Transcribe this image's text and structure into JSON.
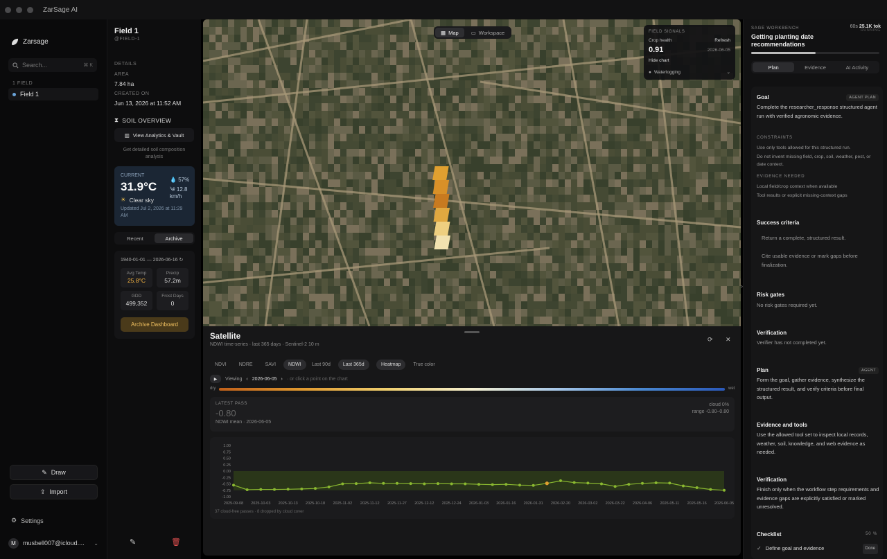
{
  "app": {
    "title": "ZarSage AI"
  },
  "nav": {
    "brand": "Zarsage",
    "search_placeholder": "Search...",
    "search_kbd": "⌘ K",
    "section": "1 FIELD",
    "items": [
      {
        "label": "Field 1"
      }
    ],
    "draw": "Draw",
    "import": "Import",
    "settings": "Settings",
    "user_initial": "M",
    "user_email": "musbell007@icloud...."
  },
  "field": {
    "name": "Field 1",
    "id": "@FIELD-1",
    "details": "DETAILS",
    "area_label": "AREA",
    "area": "7.84 ha",
    "created_label": "CREATED ON",
    "created": "Jun 13, 2026 at 11:52 AM",
    "soil_header": "SOIL OVERVIEW",
    "vault_btn": "View Analytics & Vault",
    "soil_note": "Get detailed soil composition analysis"
  },
  "weather": {
    "label": "CURRENT",
    "temp": "31.9°C",
    "sky": "Clear sky",
    "humidity": "57%",
    "wind": "12.8 km/h",
    "updated": "Updated Jul 2, 2026 at 11:29 AM"
  },
  "history": {
    "tabs": [
      "Recent",
      "Archive"
    ],
    "range": "1940-01-01 — 2026-06-16",
    "stats": [
      {
        "k": "Avg Temp",
        "v": "25.8°C"
      },
      {
        "k": "Precip",
        "v": "57.2m"
      },
      {
        "k": "GDD",
        "v": "499,352"
      },
      {
        "k": "Frost Days",
        "v": "0"
      }
    ],
    "button": "Archive Dashboard"
  },
  "map": {
    "toggle": [
      "Map",
      "Workspace"
    ],
    "signals": {
      "header": "FIELD SIGNALS",
      "crop_label": "Crop health",
      "refresh": "Refresh",
      "value": "0.91",
      "date": "2026-06-05",
      "hide": "Hide chart",
      "alert": "Waterlogging"
    }
  },
  "satellite": {
    "title": "Satellite",
    "subtitle": "NDWI time-series · last 365 days · Sentinel-2 10 m",
    "indices": [
      "NDVI",
      "NDRE",
      "SAVI",
      "NDWI"
    ],
    "ranges": [
      "Last 90d",
      "Last 365d"
    ],
    "modes": [
      "Heatmap",
      "True color"
    ],
    "viewing": "Viewing",
    "date": "2026-06-05",
    "hint": "· or click a point on the chart",
    "dry": "dry",
    "wet": "wet",
    "latest_label": "LATEST PASS",
    "latest_value": "-0.80",
    "latest_sub": "NDWI mean · 2026-06-05",
    "cloud": "cloud 0%",
    "range": "range -0.80–0.80",
    "footer": "37 cloud-free passes · 8 dropped by cloud cover"
  },
  "chart_data": {
    "type": "line",
    "title": "",
    "xlabel": "",
    "ylabel": "",
    "ylim": [
      -1,
      1
    ],
    "yticks": [
      "1.00",
      "0.75",
      "0.50",
      "0.25",
      "0.00",
      "-0.25",
      "-0.50",
      "-0.75",
      "-1.00"
    ],
    "categories": [
      "2025-09-08",
      "2025-10-03",
      "2025-10-13",
      "2025-10-18",
      "2025-11-02",
      "2025-11-12",
      "2025-11-27",
      "2025-12-12",
      "2025-12-24",
      "2026-01-03",
      "2026-01-16",
      "2026-01-31",
      "2026-02-20",
      "2026-03-02",
      "2026-03-22",
      "2026-04-06",
      "2026-05-11",
      "2026-05-16",
      "2026-06-05"
    ],
    "values": [
      -0.55,
      -0.73,
      -0.72,
      -0.72,
      -0.71,
      -0.7,
      -0.68,
      -0.62,
      -0.5,
      -0.49,
      -0.46,
      -0.48,
      -0.48,
      -0.49,
      -0.5,
      -0.49,
      -0.5,
      -0.5,
      -0.52,
      -0.53,
      -0.52,
      -0.55,
      -0.56,
      -0.48,
      -0.38,
      -0.45,
      -0.47,
      -0.5,
      -0.6,
      -0.52,
      -0.48,
      -0.46,
      -0.47,
      -0.58,
      -0.65,
      -0.72,
      -0.75
    ],
    "highlight_index": 23
  },
  "sage": {
    "header": "SAGE WORKBENCH",
    "tokens": "25.1K tok",
    "elapsed": "60s",
    "status": "RUNNING",
    "title": "Getting planting date recommendations",
    "progress": 0.5,
    "tabs": [
      "Plan",
      "Evidence",
      "AI Activity"
    ],
    "goal": "Goal",
    "goal_pill": "AGENT PLAN",
    "goal_text": "Complete the researcher_response structured agent run with verified agronomic evidence.",
    "constraints": "CONSTRAINTS",
    "c1": "Use only tools allowed for this structured run.",
    "c2": "Do not invent missing field, crop, soil, weather, pest, or date context.",
    "evidence": "EVIDENCE NEEDED",
    "e1": "Local field/crop context when available",
    "e2": "Tool results or explicit missing-context gaps",
    "success": "Success criteria",
    "s1": "Return a complete, structured result.",
    "s2": "Cite usable evidence or mark gaps before finalization.",
    "risk": "Risk gates",
    "risk_text": "No risk gates required yet.",
    "verif": "Verification",
    "verif_text": "Verifier has not completed yet.",
    "plan": "Plan",
    "plan_pill": "AGENT",
    "plan_text": "Form the goal, gather evidence, synthesize the structured result, and verify criteria before final output.",
    "tools": "Evidence and tools",
    "tools_text": "Use the allowed tool set to inspect local records, weather, soil, knowledge, and web evidence as needed.",
    "verif2": "Verification",
    "verif2_text": "Finish only when the workflow step requirements and evidence gaps are explicitly satisfied or marked unresolved.",
    "checklist": "Checklist",
    "check_pct": "50 %",
    "check1": "Define goal and evidence",
    "check1_state": "Done"
  }
}
